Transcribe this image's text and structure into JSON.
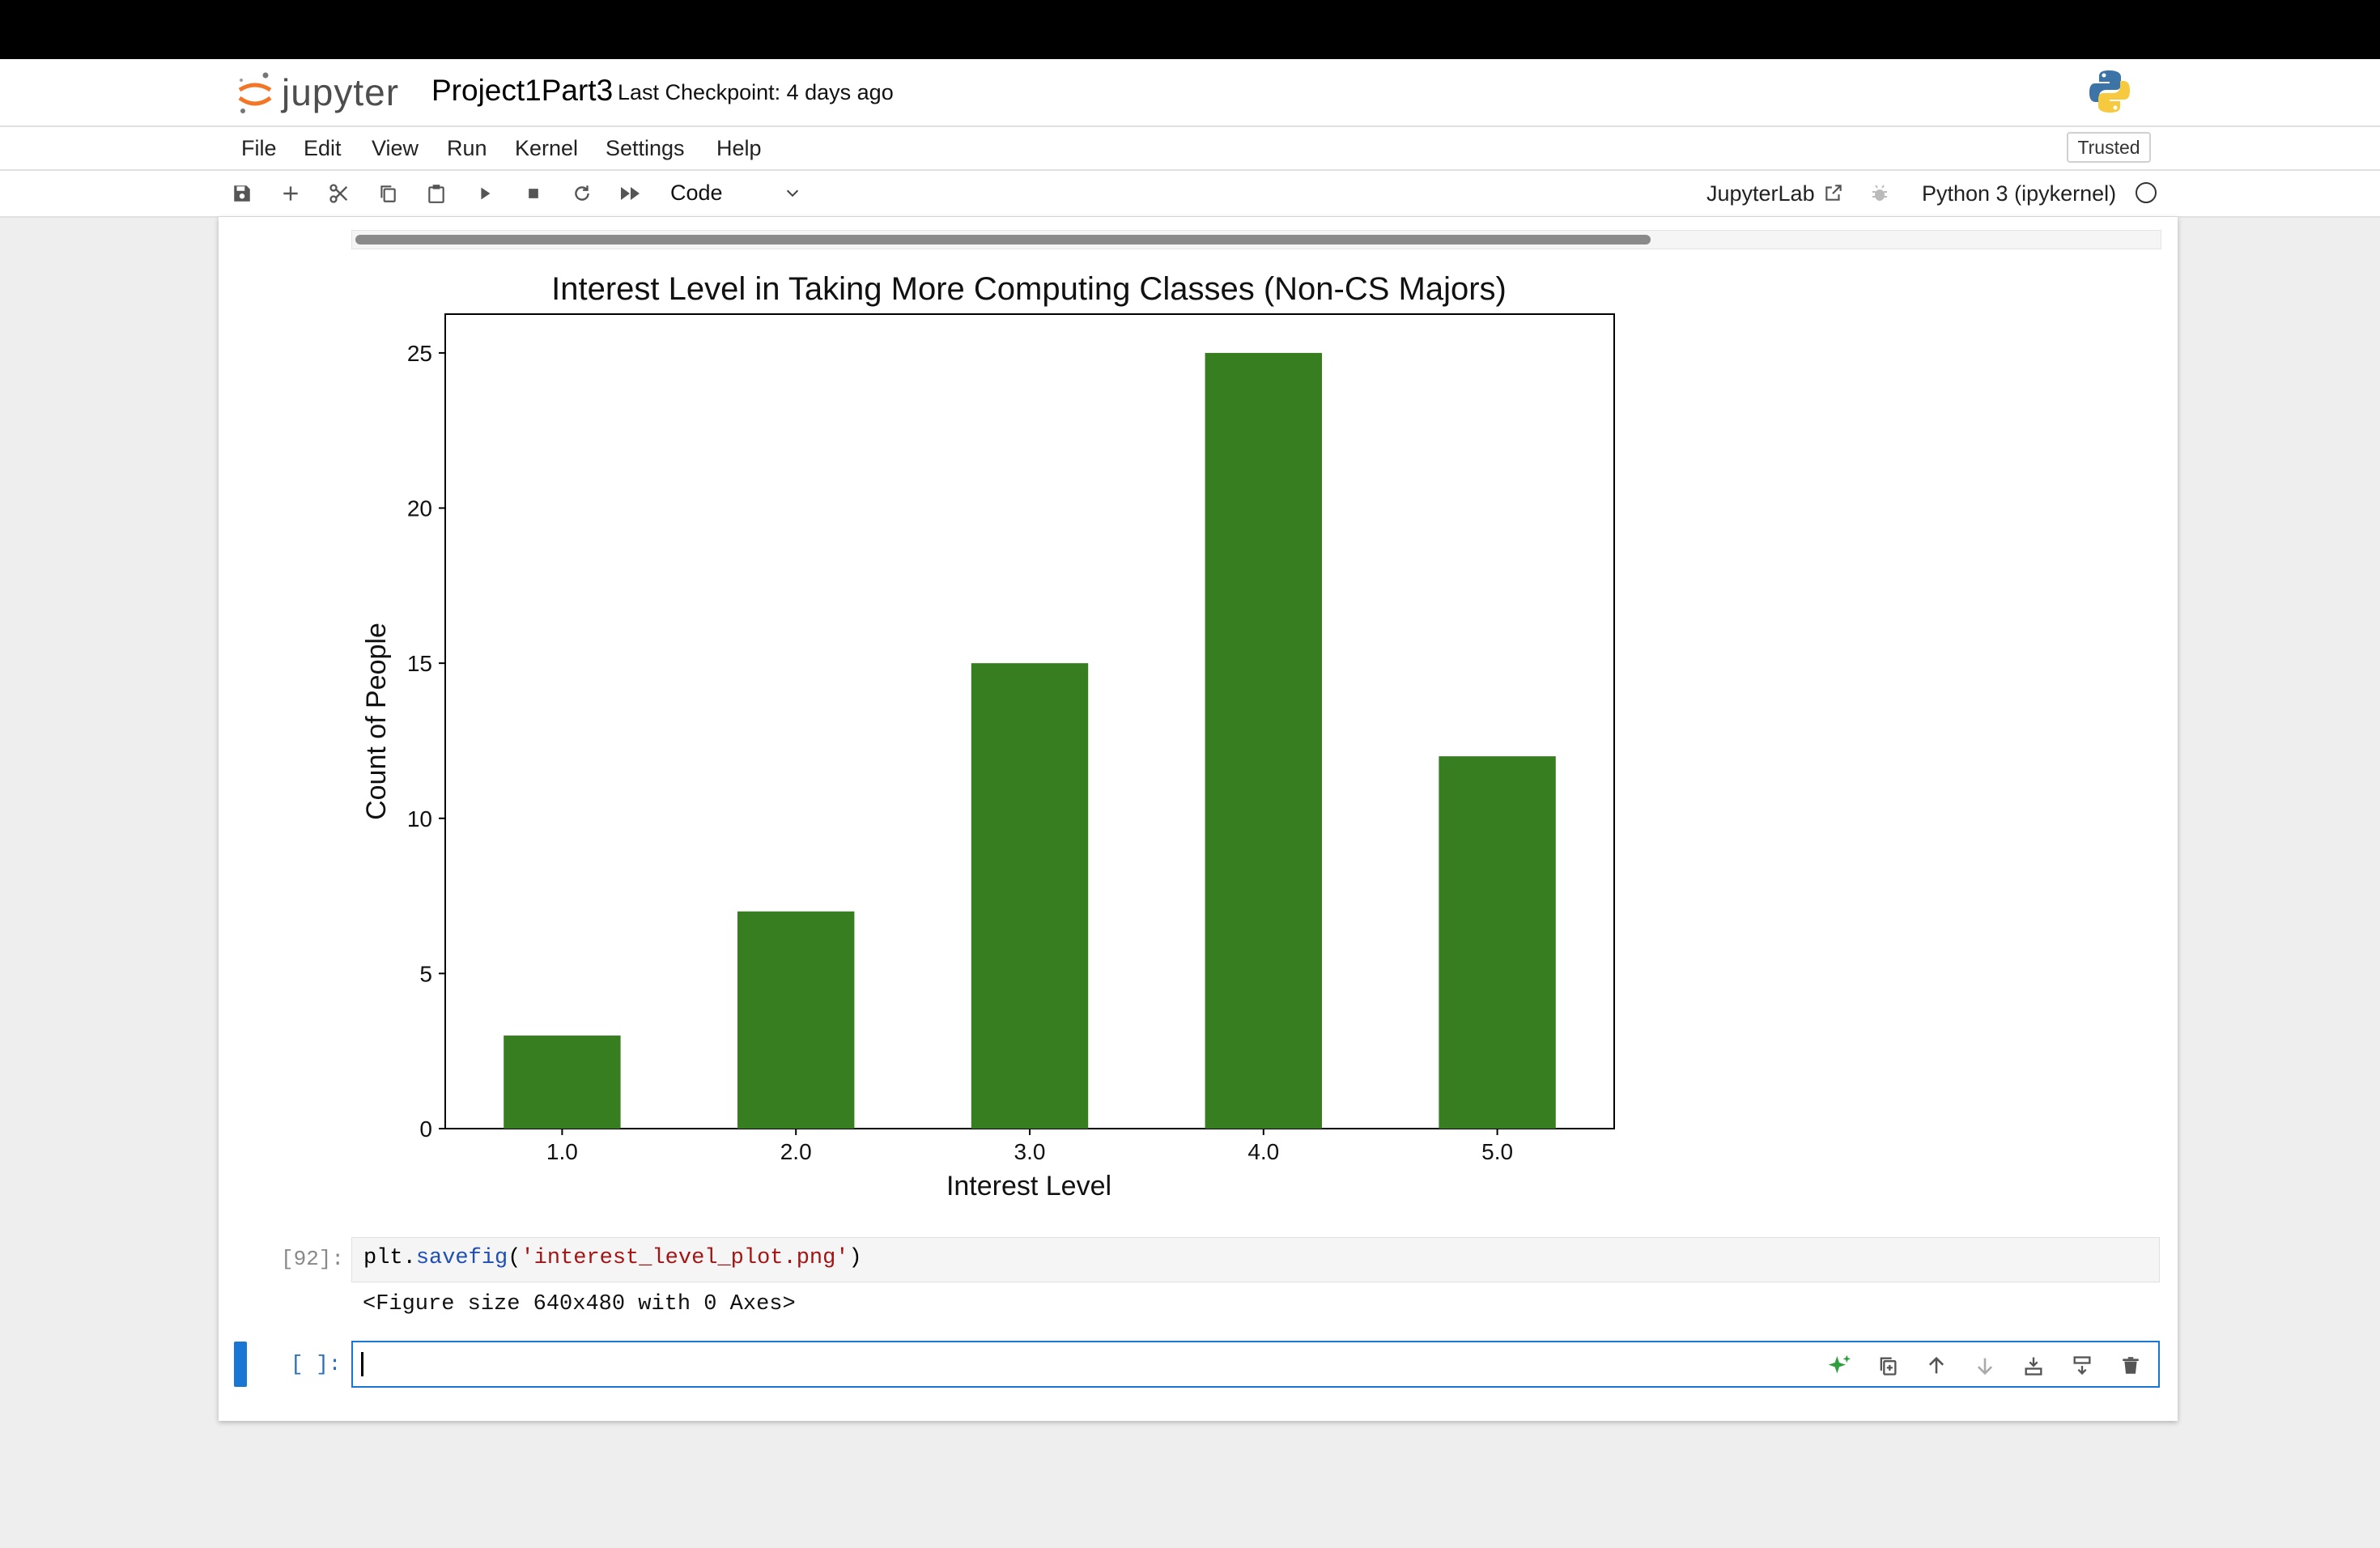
{
  "app": {
    "logo_text": "jupyter",
    "notebook_title": "Project1Part3",
    "checkpoint": "Last Checkpoint: 4 days ago"
  },
  "menu": {
    "items": [
      "File",
      "Edit",
      "View",
      "Run",
      "Kernel",
      "Settings",
      "Help"
    ],
    "trusted": "Trusted"
  },
  "toolbar": {
    "icons": [
      "save-icon",
      "add-cell-icon",
      "cut-icon",
      "copy-icon",
      "paste-icon",
      "run-icon",
      "stop-icon",
      "restart-icon",
      "fast-forward-icon"
    ],
    "cell_type": "Code",
    "jupyterlab_label": "JupyterLab",
    "kernel_name": "Python 3 (ipykernel)"
  },
  "cells": [
    {
      "prompt": "[92]:",
      "code_var": "plt",
      "code_dot": ".",
      "code_fn": "savefig",
      "code_open": "(",
      "code_str": "'interest_level_plot.png'",
      "code_close": ")",
      "output": "<Figure size 640x480 with 0 Axes>"
    },
    {
      "prompt": "[ ]:"
    }
  ],
  "colors": {
    "bar": "#367e20",
    "accent": "#1976d2"
  },
  "chart_data": {
    "type": "bar",
    "title": "Interest Level in Taking More Computing Classes (Non-CS Majors)",
    "xlabel": "Interest Level",
    "ylabel": "Count of People",
    "categories": [
      "1.0",
      "2.0",
      "3.0",
      "4.0",
      "5.0"
    ],
    "values": [
      3,
      7,
      15,
      25,
      12
    ],
    "yticks": [
      0,
      5,
      10,
      15,
      20,
      25
    ],
    "ylim": [
      0,
      26.25
    ],
    "grid": false,
    "legend": "none"
  }
}
